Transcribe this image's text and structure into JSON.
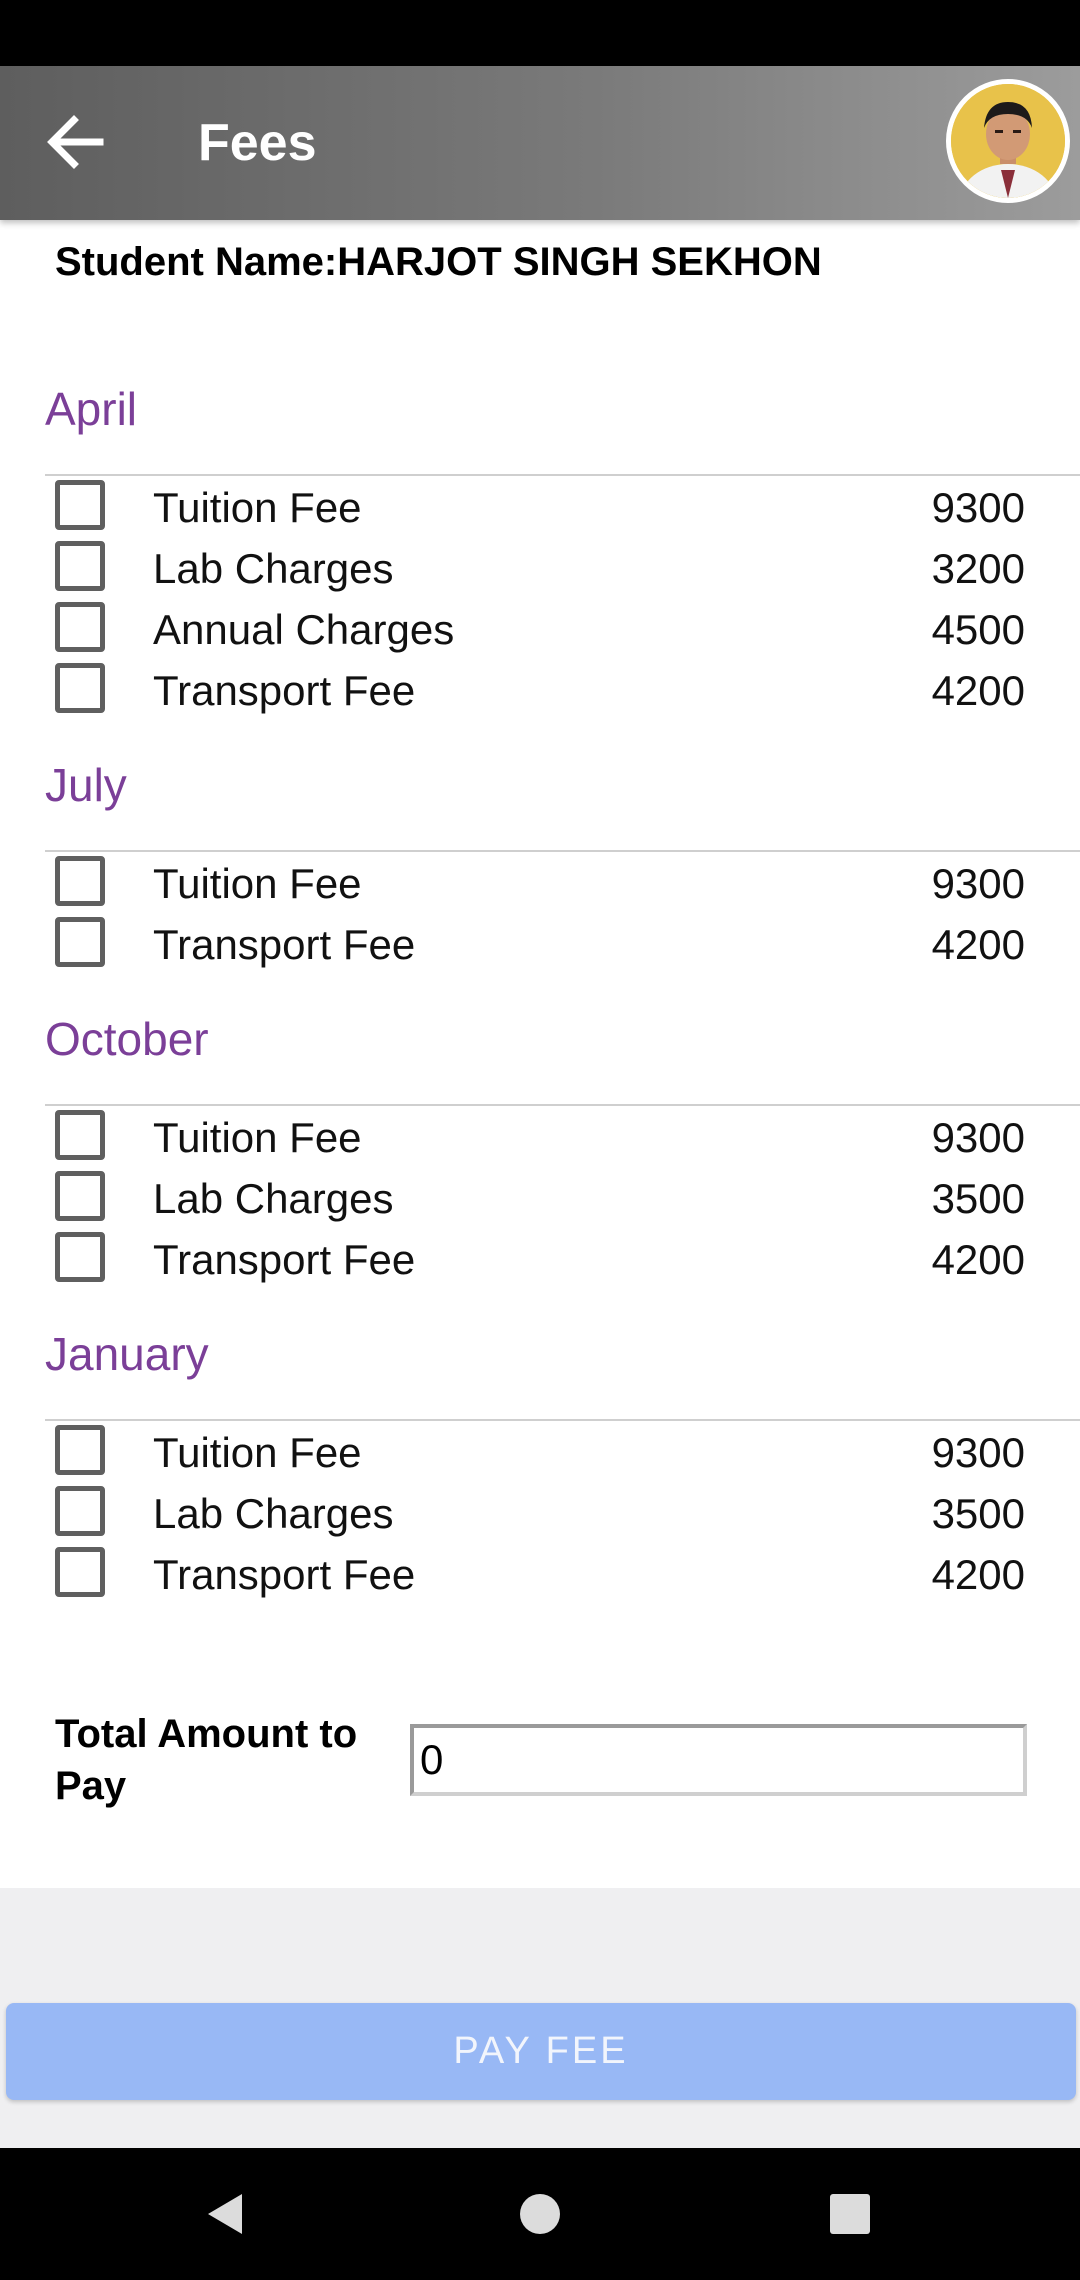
{
  "app_bar": {
    "title": "Fees"
  },
  "student": {
    "label": "Student Name:",
    "name": "HARJOT SINGH SEKHON"
  },
  "months": [
    {
      "name": "April",
      "fees": [
        {
          "label": "Tuition Fee",
          "amount": "9300"
        },
        {
          "label": "Lab Charges",
          "amount": "3200"
        },
        {
          "label": "Annual Charges",
          "amount": "4500"
        },
        {
          "label": "Transport Fee",
          "amount": "4200"
        }
      ]
    },
    {
      "name": "July",
      "fees": [
        {
          "label": "Tuition Fee",
          "amount": "9300"
        },
        {
          "label": "Transport Fee",
          "amount": "4200"
        }
      ]
    },
    {
      "name": "October",
      "fees": [
        {
          "label": "Tuition Fee",
          "amount": "9300"
        },
        {
          "label": "Lab Charges",
          "amount": "3500"
        },
        {
          "label": "Transport Fee",
          "amount": "4200"
        }
      ]
    },
    {
      "name": "January",
      "fees": [
        {
          "label": "Tuition Fee",
          "amount": "9300"
        },
        {
          "label": "Lab Charges",
          "amount": "3500"
        },
        {
          "label": "Transport Fee",
          "amount": "4200"
        }
      ]
    }
  ],
  "total": {
    "label": "Total Amount to Pay",
    "value": "0"
  },
  "pay_button": {
    "label": "PAY FEE"
  },
  "colors": {
    "month_title": "#7b3f98",
    "pay_button": "#98b8f5",
    "app_bar": "#6e6e6e"
  },
  "icons": {
    "back": "arrow-left-icon",
    "nav_back": "triangle-back-icon",
    "nav_home": "circle-home-icon",
    "nav_recents": "square-recents-icon"
  }
}
